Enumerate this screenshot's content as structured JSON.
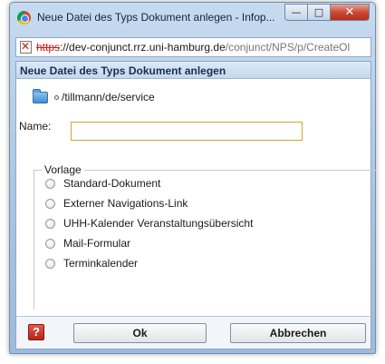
{
  "window": {
    "title": "Neue Datei des Typs Dokument anlegen - Infop...",
    "minimize_symbol": "—",
    "maximize_symbol": "□",
    "close_symbol": "✕"
  },
  "address_bar": {
    "protocol": "https",
    "host": "://dev-conjunct.rrz.uni-hamburg.de",
    "path": "/conjunct/NPS/p/CreateOl"
  },
  "dialog": {
    "header": "Neue Datei des Typs Dokument anlegen",
    "folder_path": "/tillmann/de/service",
    "name_label": "Name:",
    "name_value": "",
    "template_legend": "Vorlage",
    "templates": [
      "Standard-Dokument",
      "Externer Navigations-Link",
      "UHH-Kalender Veranstaltungsübersicht",
      "Mail-Formular",
      "Terminkalender"
    ],
    "help_symbol": "?",
    "ok_label": "Ok",
    "cancel_label": "Abbrechen"
  },
  "icons": {
    "browser": "chrome-icon",
    "page": "insecure-page-icon",
    "folder": "folder-icon",
    "help": "help-icon"
  }
}
